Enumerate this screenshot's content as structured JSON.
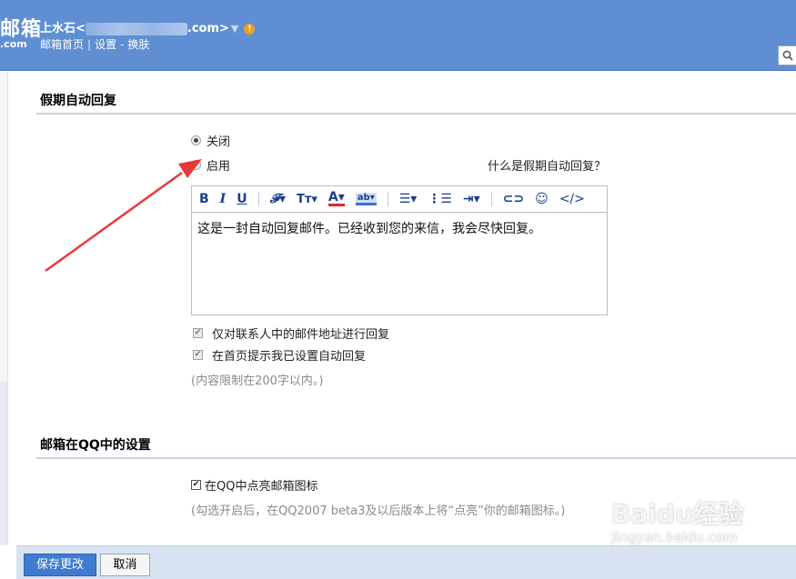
{
  "header": {
    "logo": "邮箱",
    "logo_sub": ".com",
    "account_prefix": "上水石<",
    "account_suffix": ".com>",
    "nav": [
      "邮箱首页",
      "设置",
      "换肤"
    ],
    "nav_seps": [
      "|",
      "-"
    ]
  },
  "vacation": {
    "title": "假期自动回复",
    "off_label": "关闭",
    "on_label": "启用",
    "selected": "off",
    "help_link": "什么是假期自动回复？",
    "editor_text": "这是一封自动回复邮件。已经收到您的来信，我会尽快回复。",
    "option_contacts": "仅对联系人中的邮件地址进行回复",
    "option_homepage": "在首页提示我已设置自动回复",
    "limit_hint": "(内容限制在200字以内。)"
  },
  "qq": {
    "title": "邮箱在QQ中的设置",
    "option_icon": "在QQ中点亮邮箱图标",
    "icon_hint": "(勾选开启后，在QQ2007 beta3及以后版本上将“点亮”你的邮箱图标。)"
  },
  "toolbar_icons": [
    "bold-icon",
    "italic-icon",
    "underline-icon",
    "font-icon",
    "font-size-icon",
    "font-color-icon",
    "background-color-icon",
    "align-icon",
    "list-icon",
    "indent-icon",
    "link-icon",
    "emoji-icon",
    "html-icon"
  ],
  "footer": {
    "save_label": "保存更改",
    "cancel_label": "取消"
  },
  "watermark": {
    "brand": "Baidu经验",
    "url": "jingyan.baidu.com"
  },
  "colors": {
    "header": "#5f8fd2",
    "save_button": "#3f7bd0",
    "annotation_arrow": "#e8393a"
  }
}
